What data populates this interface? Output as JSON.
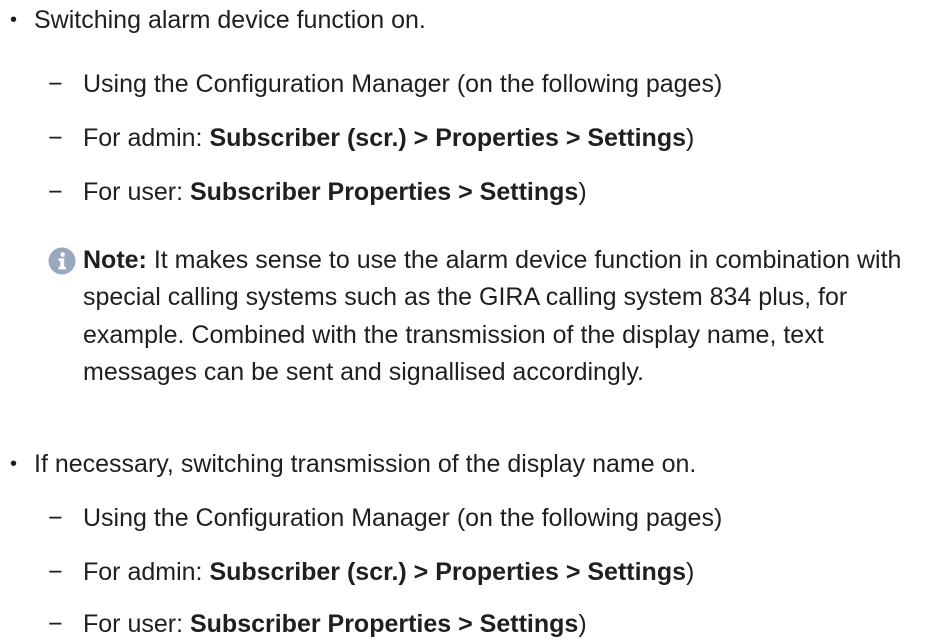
{
  "colors": {
    "text": "#1f1f1f",
    "note_icon": "#9aa8bd"
  },
  "icons": {
    "note": "info-icon"
  },
  "section1": {
    "bullet": "•",
    "text": "Switching alarm device function on.",
    "items": [
      {
        "dash": "−",
        "prefix": "Using the Configuration Manager (on the following pages)",
        "bold": "",
        "suffix": ""
      },
      {
        "dash": "−",
        "prefix": "For admin: ",
        "bold": "Subscriber (scr.) > Properties > Settings",
        "suffix": ")"
      },
      {
        "dash": "−",
        "prefix": "For user: ",
        "bold": "Subscriber Properties > Settings",
        "suffix": ")"
      }
    ]
  },
  "note": {
    "label": "Note:",
    "text": " It makes sense to use the alarm device function in combination with special calling systems such as the GIRA calling system 834 plus, for example. Combined with the transmission of the display name, text messages can be sent and signallised accordingly."
  },
  "section2": {
    "bullet": "•",
    "text": "If necessary, switching transmission of the display name on.",
    "items": [
      {
        "dash": "−",
        "prefix": "Using the Configuration Manager (on the following pages)",
        "bold": "",
        "suffix": ""
      },
      {
        "dash": "−",
        "prefix": "For admin: ",
        "bold": "Subscriber (scr.) > Properties > Settings",
        "suffix": ")"
      },
      {
        "dash": "−",
        "prefix": "For user: ",
        "bold": "Subscriber Properties > Settings",
        "suffix": ")"
      }
    ]
  }
}
